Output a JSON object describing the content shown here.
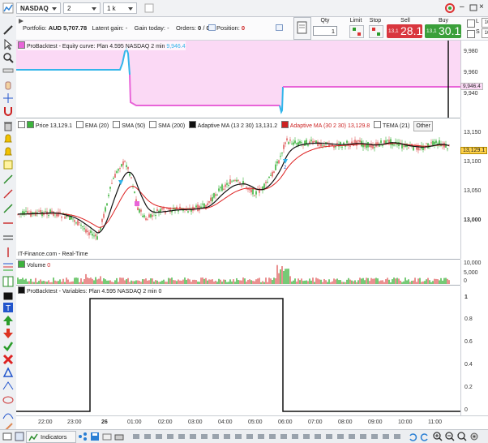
{
  "topbar": {
    "instrument": "NASDAQ",
    "timeframe": "2 minutes",
    "units": "1 k units"
  },
  "info": {
    "portfolio_label": "Portfolio:",
    "portfolio_value": "AUD 5,707.78",
    "latent_label": "Latent gain:",
    "latent_value": "-",
    "gain_today_label": "Gain today:",
    "gain_today_value": "-",
    "orders_label": "Orders:",
    "orders_value": "0",
    "orders_sep": "/",
    "orders_value2": "0",
    "position_label": "Position:",
    "position_value": "0"
  },
  "order_panel": {
    "qty_label": "Qty",
    "qty_value": "1",
    "limit_label": "Limit",
    "stop_label": "Stop",
    "sell_label": "Sell",
    "sell_price_small": "13,1",
    "sell_price_big": "28.1",
    "buy_label": "Buy",
    "buy_price_small": "13,1",
    "buy_price_big": "30.1",
    "side_l": "L",
    "side_s": "S",
    "side_l_val": "10",
    "side_s_val": "10",
    "pts": "pts"
  },
  "equity_panel": {
    "title": "ProBacktest - Equity curve: Plan 4.595 NASDAQ 2 min",
    "value": "9,946.4",
    "axis": [
      "9,980",
      "9,960",
      "9,940"
    ],
    "last_tag": "9,946.4"
  },
  "price_panel": {
    "legend": [
      {
        "label": "Price 13,129.1",
        "color": "#333333"
      },
      {
        "label": "EMA (20)",
        "color": "#333333"
      },
      {
        "label": "SMA (50)",
        "color": "#333333"
      },
      {
        "label": "SMA (200)",
        "color": "#333333"
      },
      {
        "label": "Adaptive MA (13 2 30) 13,131.2",
        "color": "#111111"
      },
      {
        "label": "Adaptive MA (30 2 30) 13,129.8",
        "color": "#cc2222"
      },
      {
        "label": "TEMA (21)",
        "color": "#333333"
      },
      {
        "label": "Other",
        "color": "#333333"
      }
    ],
    "axis": [
      "13,150",
      "13,100",
      "13,050",
      "13,000"
    ],
    "last_tag": "13,129.1",
    "watermark": "IT-Finance.com - Real-Time",
    "marker_label": "2"
  },
  "volume_panel": {
    "title": "Volume",
    "value": "0",
    "axis": [
      "10,000",
      "5,000",
      "0"
    ]
  },
  "variables_panel": {
    "title": "ProBacktest - Variables: Plan 4.595 NASDAQ 2 min",
    "value": "0",
    "axis": [
      "1",
      "0.8",
      "0.6",
      "0.4",
      "0.2",
      "0"
    ]
  },
  "time_axis": [
    "22:00",
    "23:00",
    "26",
    "01:00",
    "02:00",
    "03:00",
    "04:00",
    "05:00",
    "06:00",
    "07:00",
    "08:00",
    "09:00",
    "10:00",
    "11:00"
  ],
  "bottombar": {
    "indicators_label": "Indicators"
  },
  "colors": {
    "equity_fill": "#fbd9f5",
    "equity_line_up": "#33b5ea",
    "equity_line_down": "#e864d8",
    "ma_fast": "#111111",
    "ma_slow": "#dd2222",
    "candle_up": "#3cb33c",
    "candle_down": "#e06060",
    "sell_bg": "#d9363e",
    "buy_bg": "#3a9f3a"
  }
}
